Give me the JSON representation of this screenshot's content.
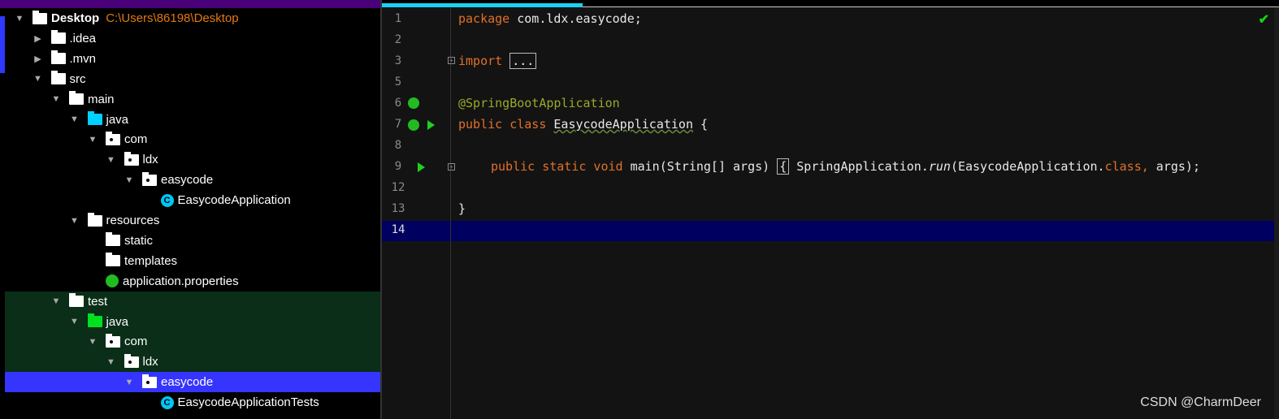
{
  "project": {
    "root_name": "Desktop",
    "root_path": "C:\\Users\\86198\\Desktop",
    "items": [
      {
        "label": ".idea",
        "depth": 1,
        "expanded": false,
        "icon": "folder-icon"
      },
      {
        "label": ".mvn",
        "depth": 1,
        "expanded": false,
        "icon": "folder-icon"
      },
      {
        "label": "src",
        "depth": 1,
        "expanded": true,
        "icon": "folder-icon"
      },
      {
        "label": "main",
        "depth": 2,
        "expanded": true,
        "icon": "folder-icon"
      },
      {
        "label": "java",
        "depth": 3,
        "expanded": true,
        "icon": "source-folder-icon"
      },
      {
        "label": "com",
        "depth": 4,
        "expanded": true,
        "icon": "package-icon"
      },
      {
        "label": "ldx",
        "depth": 5,
        "expanded": true,
        "icon": "package-icon"
      },
      {
        "label": "easycode",
        "depth": 6,
        "expanded": true,
        "icon": "package-icon"
      },
      {
        "label": "EasycodeApplication",
        "depth": 7,
        "icon": "spring-class-icon"
      },
      {
        "label": "resources",
        "depth": 3,
        "expanded": true,
        "icon": "resources-folder-icon"
      },
      {
        "label": "static",
        "depth": 4,
        "icon": "folder-icon"
      },
      {
        "label": "templates",
        "depth": 4,
        "icon": "folder-icon"
      },
      {
        "label": "application.properties",
        "depth": 4,
        "icon": "spring-properties-icon"
      },
      {
        "label": "test",
        "depth": 2,
        "expanded": true,
        "icon": "folder-icon"
      },
      {
        "label": "java",
        "depth": 3,
        "expanded": true,
        "icon": "test-folder-icon"
      },
      {
        "label": "com",
        "depth": 4,
        "expanded": true,
        "icon": "package-icon"
      },
      {
        "label": "ldx",
        "depth": 5,
        "expanded": true,
        "icon": "package-icon"
      },
      {
        "label": "easycode",
        "depth": 6,
        "expanded": true,
        "icon": "package-icon",
        "selected": true
      },
      {
        "label": "EasycodeApplicationTests",
        "depth": 7,
        "icon": "test-class-icon"
      }
    ]
  },
  "editor": {
    "line_numbers": [
      "1",
      "2",
      "3",
      "5",
      "6",
      "7",
      "8",
      "9",
      "12",
      "13",
      "14"
    ],
    "current_line": "14",
    "code": {
      "l1_kw": "package",
      "l1_rest": " com.ldx.easycode;",
      "l3_kw": "import",
      "l3_fold": "...",
      "l6_ann": "@SpringBootApplication",
      "l7_kw": "public class",
      "l7_name": "EasycodeApplication",
      "l7_rest": " {",
      "l9_kw": "public static void",
      "l9_a": " main(String[] args) ",
      "l9_brace": "{",
      "l9_b": " SpringApplication.",
      "l9_run": "run",
      "l9_c": "(EasycodeApplication.",
      "l9_class": "class,",
      "l9_d": " args);",
      "l13": "}"
    }
  },
  "watermark": "CSDN @CharmDeer",
  "colors": {
    "keyword": "#e0702a",
    "annotation": "#9aa82a",
    "current_line": "#000060",
    "selection": "#3535ff",
    "test_bg": "#0a2e18",
    "title_bar": "#4a0078"
  }
}
